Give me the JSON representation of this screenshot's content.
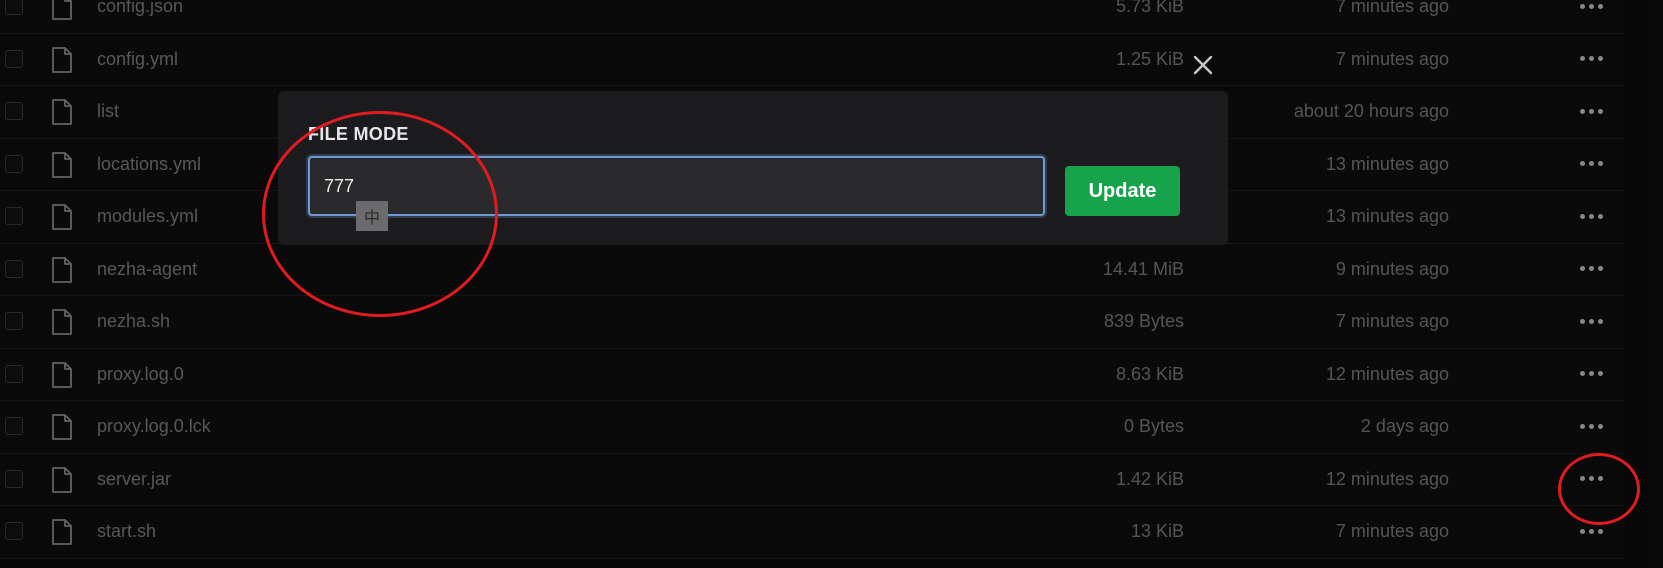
{
  "files": [
    {
      "name": "config.json",
      "size": "5.73 KiB",
      "modified": "7 minutes ago"
    },
    {
      "name": "config.yml",
      "size": "1.25 KiB",
      "modified": "7 minutes ago"
    },
    {
      "name": "list",
      "size": "",
      "modified": "about 20 hours ago"
    },
    {
      "name": "locations.yml",
      "size": "",
      "modified": "13 minutes ago"
    },
    {
      "name": "modules.yml",
      "size": "",
      "modified": "13 minutes ago"
    },
    {
      "name": "nezha-agent",
      "size": "14.41 MiB",
      "modified": "9 minutes ago"
    },
    {
      "name": "nezha.sh",
      "size": "839 Bytes",
      "modified": "7 minutes ago"
    },
    {
      "name": "proxy.log.0",
      "size": "8.63 KiB",
      "modified": "12 minutes ago"
    },
    {
      "name": "proxy.log.0.lck",
      "size": "0 Bytes",
      "modified": "2 days ago"
    },
    {
      "name": "server.jar",
      "size": "1.42 KiB",
      "modified": "12 minutes ago"
    },
    {
      "name": "start.sh",
      "size": "13 KiB",
      "modified": "7 minutes ago"
    }
  ],
  "modal": {
    "label": "FILE MODE",
    "input_value": "777",
    "update_label": "Update",
    "ime_indicator": "中"
  },
  "colors": {
    "accent_green": "#17a24c",
    "annotation_red": "#e11b22",
    "input_focus_border": "#6e9bd6"
  }
}
